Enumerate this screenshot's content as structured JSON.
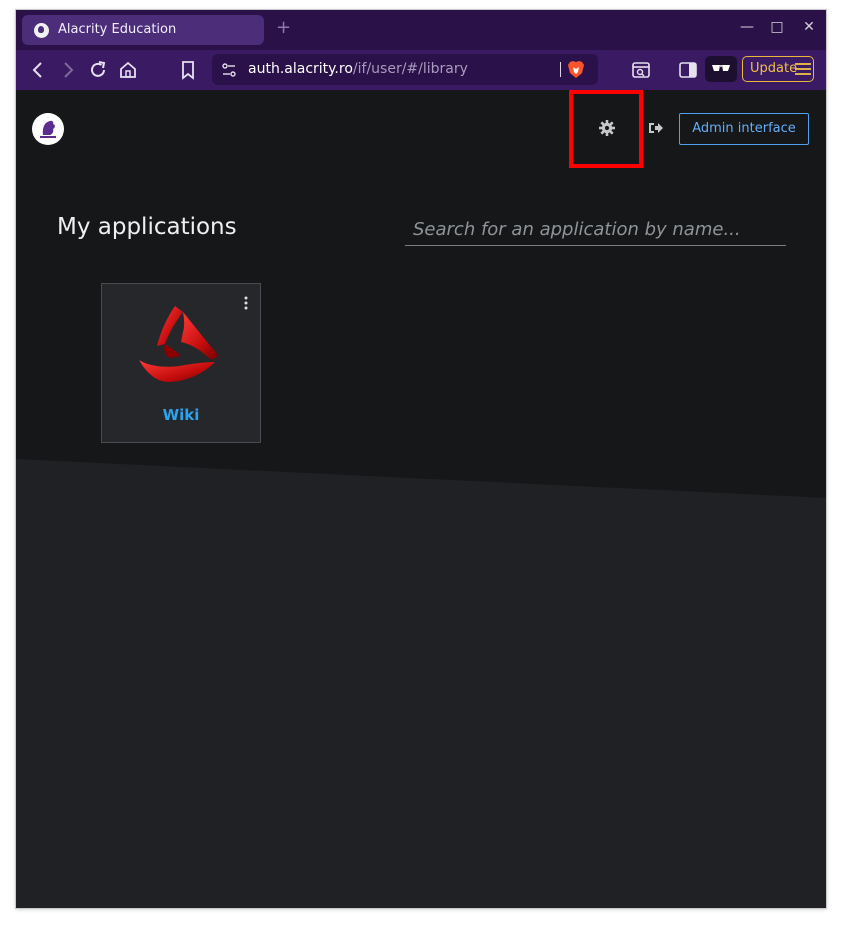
{
  "browser": {
    "tab_title": "Alacrity Education",
    "new_tab_icon": "plus",
    "url_host": "auth.alacrity.ro",
    "url_path": "/if/user/#/library",
    "update_label": "Update",
    "accent_color": "#3a1a63"
  },
  "header": {
    "admin_button_label": "Admin interface",
    "settings_icon": "gear-icon",
    "logout_icon": "sign-out-icon",
    "highlight_color": "#ff0000"
  },
  "main": {
    "title": "My applications",
    "search_placeholder": "Search for an application by name...",
    "applications": [
      {
        "name": "Wiki",
        "icon": "red-triangle-logo"
      }
    ]
  }
}
